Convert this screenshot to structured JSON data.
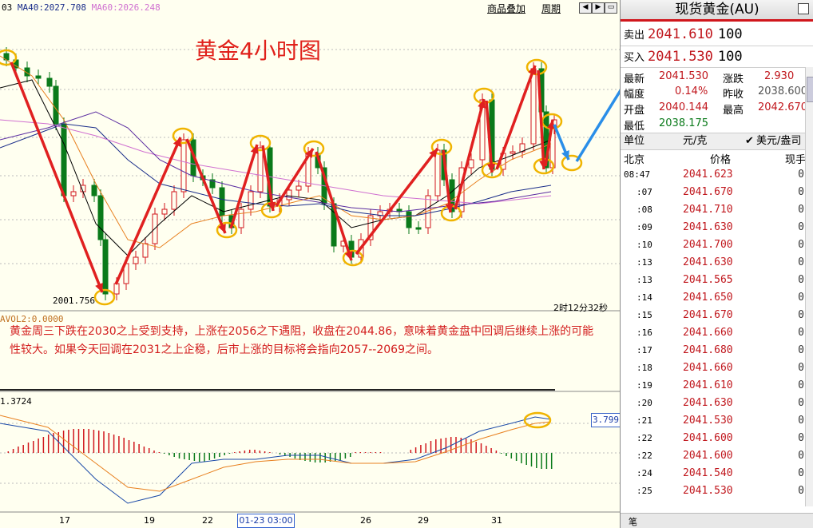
{
  "chart": {
    "ma_text": {
      "ma_a": "03",
      "ma40": "MA40:2027.708",
      "ma60": "MA60:2026.248"
    },
    "toolbar": {
      "overlay": "商品叠加",
      "period": "周期"
    },
    "title": "黄金4小时图",
    "low_label": "2001.756",
    "countdown": "2时12分32秒",
    "vol_label": "AVOL2:0.0000",
    "commentary": "黄金周三下跌在2030之上受到支持，上涨在2056之下遇阻，收盘在2044.86，意味着黄金盘中回调后继续上涨的可能性较大。如果今天回调在2031之上企稳，后市上涨的目标将会指向2057--2069之间。",
    "macd_label": "1.3724",
    "macd_value": "3.799",
    "x_labels": [
      "17",
      "19",
      "22",
      "26",
      "29",
      "31"
    ],
    "x_selected": "01-23 03:00",
    "colors": {
      "up": "#d0161c",
      "down": "#0a7a1a",
      "arrow": "#e02020",
      "forecast": "#2a8ee8",
      "circle": "#f0b400"
    }
  },
  "panel": {
    "title": "现货黄金(AU)",
    "sell": {
      "label": "卖出",
      "price": "2041.610",
      "qty": "100"
    },
    "buy": {
      "label": "买入",
      "price": "2041.530",
      "qty": "100"
    },
    "stats": [
      {
        "k": "最新",
        "v": "2041.530",
        "k2": "涨跌",
        "v2": "2.930"
      },
      {
        "k": "幅度",
        "v": "0.14%",
        "k2": "昨收",
        "v2": "2038.600"
      },
      {
        "k": "开盘",
        "v": "2040.144",
        "k2": "最高",
        "v2": "2042.670"
      },
      {
        "k": "最低",
        "v": "2038.175"
      }
    ],
    "unit": {
      "label": "单位",
      "value": "元/克",
      "check": "✔",
      "currency": "美元/盎司"
    },
    "header": {
      "col1": "北京",
      "col2": "价格",
      "col3": "现手"
    },
    "ticks": [
      {
        "t": "08:47",
        "p": "2041.623",
        "h": "0"
      },
      {
        "t": ":07",
        "p": "2041.670",
        "h": "0"
      },
      {
        "t": ":08",
        "p": "2041.710",
        "h": "0"
      },
      {
        "t": ":09",
        "p": "2041.630",
        "h": "0"
      },
      {
        "t": ":10",
        "p": "2041.700",
        "h": "0"
      },
      {
        "t": ":13",
        "p": "2041.630",
        "h": "0"
      },
      {
        "t": ":13",
        "p": "2041.565",
        "h": "0"
      },
      {
        "t": ":14",
        "p": "2041.650",
        "h": "0"
      },
      {
        "t": ":15",
        "p": "2041.670",
        "h": "0"
      },
      {
        "t": ":16",
        "p": "2041.660",
        "h": "0"
      },
      {
        "t": ":17",
        "p": "2041.680",
        "h": "0"
      },
      {
        "t": ":18",
        "p": "2041.660",
        "h": "0"
      },
      {
        "t": ":19",
        "p": "2041.610",
        "h": "0"
      },
      {
        "t": ":20",
        "p": "2041.630",
        "h": "0"
      },
      {
        "t": ":21",
        "p": "2041.530",
        "h": "0"
      },
      {
        "t": ":22",
        "p": "2041.600",
        "h": "0"
      },
      {
        "t": ":22",
        "p": "2041.600",
        "h": "0"
      },
      {
        "t": ":24",
        "p": "2041.540",
        "h": "0"
      },
      {
        "t": ":25",
        "p": "2041.530",
        "h": "0"
      }
    ],
    "bottom_tab": "笔"
  }
}
